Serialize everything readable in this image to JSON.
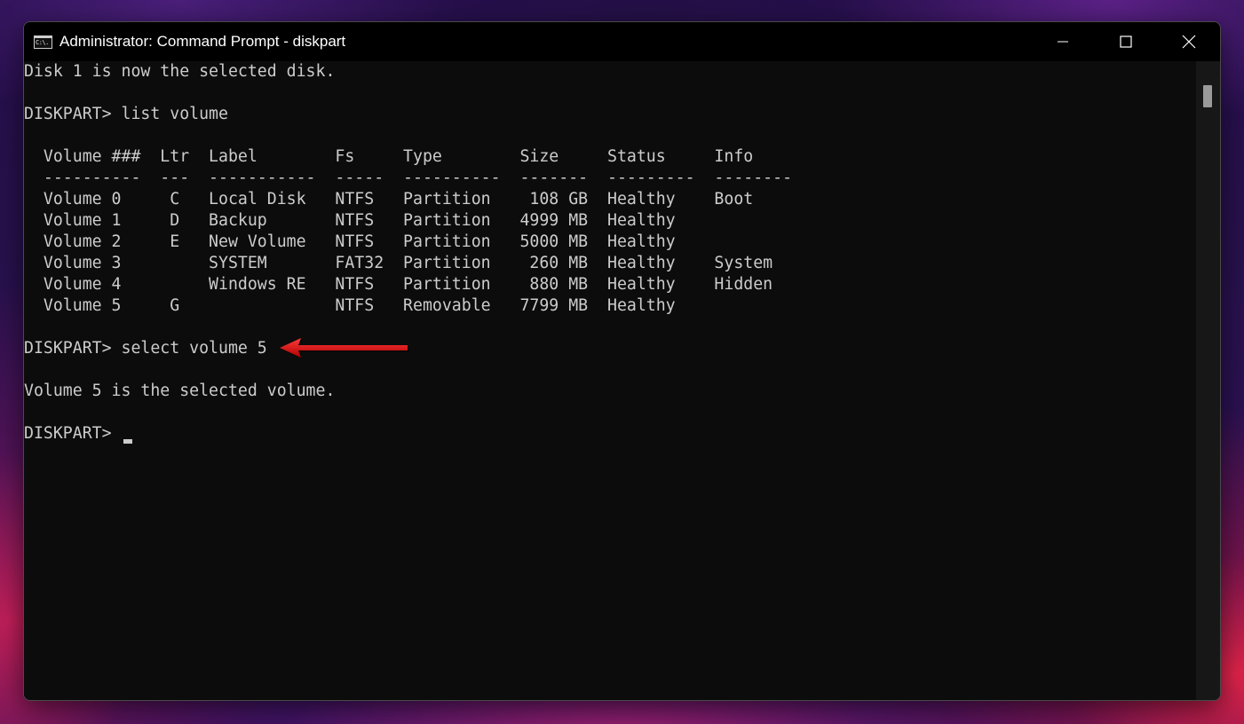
{
  "window": {
    "title": "Administrator: Command Prompt - diskpart",
    "icon_text": "C:\\."
  },
  "console": {
    "lines": [
      "Disk 1 is now the selected disk.",
      "",
      "DISKPART> list volume",
      "",
      "  Volume ###  Ltr  Label        Fs     Type        Size     Status     Info",
      "  ----------  ---  -----------  -----  ----------  -------  ---------  --------",
      "  Volume 0     C   Local Disk   NTFS   Partition    108 GB  Healthy    Boot",
      "  Volume 1     D   Backup       NTFS   Partition   4999 MB  Healthy",
      "  Volume 2     E   New Volume   NTFS   Partition   5000 MB  Healthy",
      "  Volume 3         SYSTEM       FAT32  Partition    260 MB  Healthy    System",
      "  Volume 4         Windows RE   NTFS   Partition    880 MB  Healthy    Hidden",
      "  Volume 5     G                NTFS   Removable   7799 MB  Healthy",
      "",
      "DISKPART> select volume 5",
      "",
      "Volume 5 is the selected volume.",
      "",
      "DISKPART> "
    ]
  },
  "colors": {
    "console_bg": "#0c0c0c",
    "console_text": "#cccccc",
    "titlebar_bg": "#000000",
    "annotation_arrow": "#e01010"
  },
  "icons": {
    "app": "command-prompt-icon",
    "minimize": "minimize-icon",
    "maximize": "maximize-icon",
    "close": "close-icon",
    "annotation": "red-arrow-icon"
  }
}
